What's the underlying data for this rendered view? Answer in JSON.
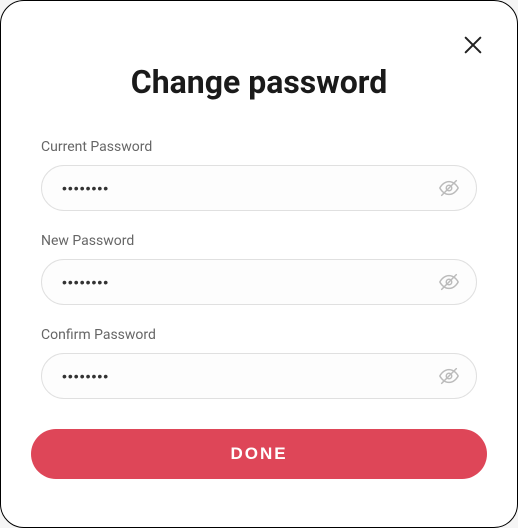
{
  "dialog": {
    "title": "Change password",
    "fields": {
      "current": {
        "label": "Current Password",
        "value": "••••••••"
      },
      "new": {
        "label": "New Password",
        "value": "••••••••"
      },
      "confirm": {
        "label": "Confirm Password",
        "value": "••••••••"
      }
    },
    "done_label": "DONE"
  }
}
